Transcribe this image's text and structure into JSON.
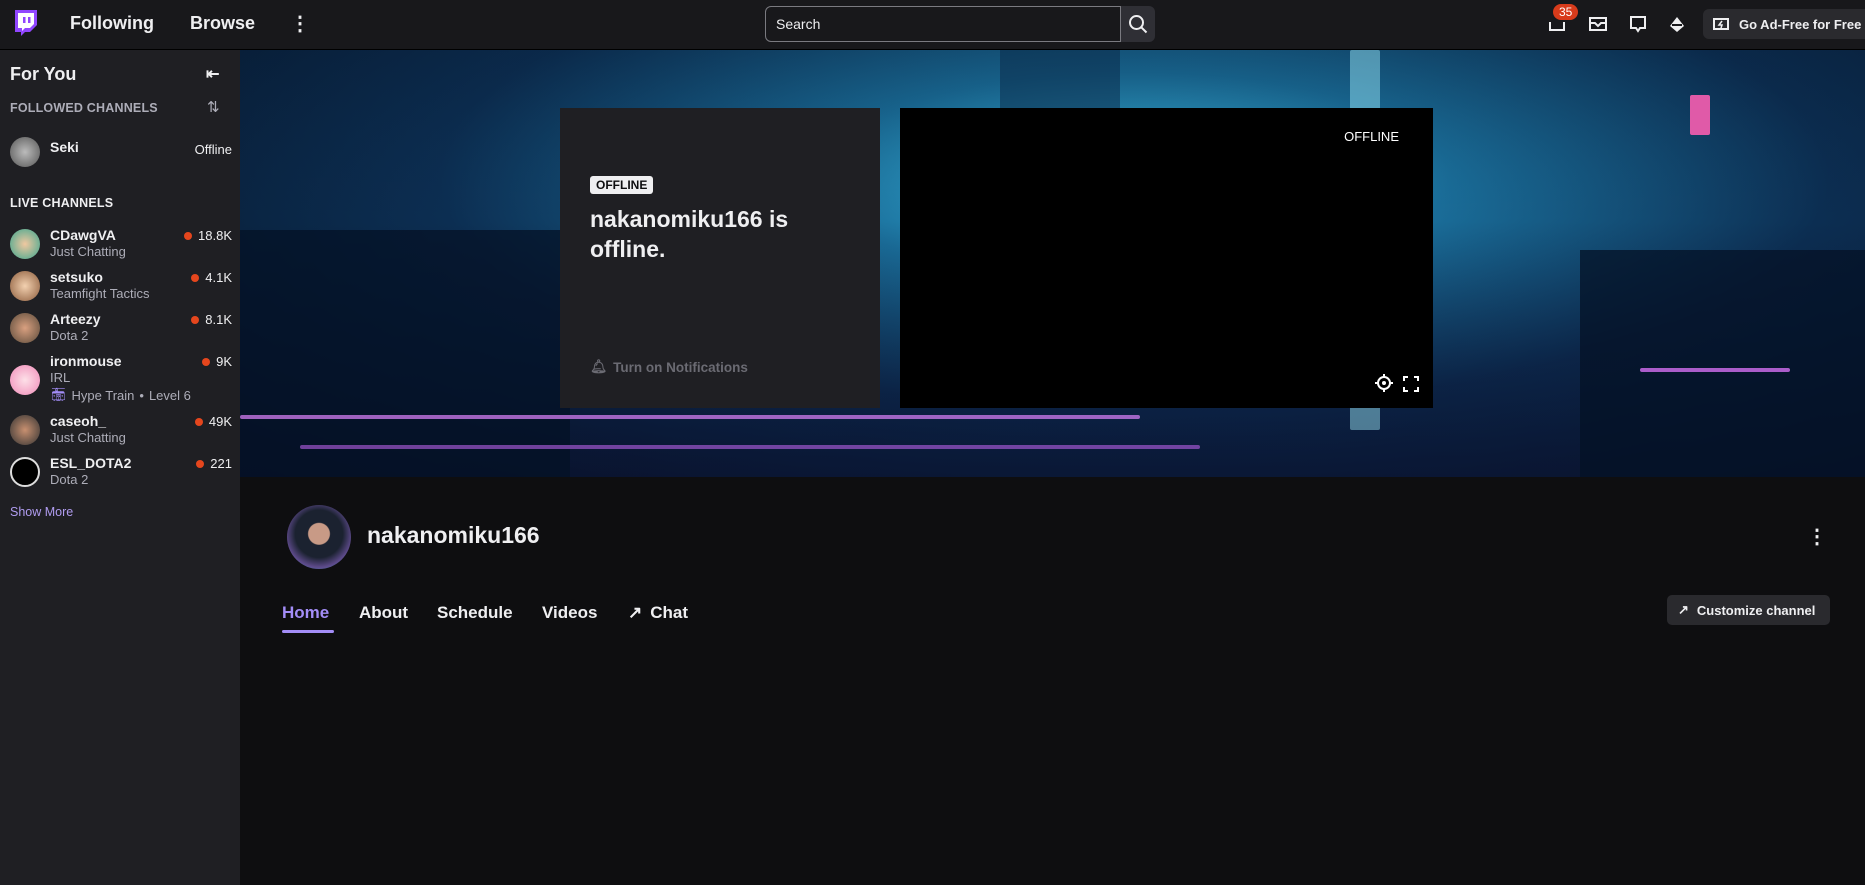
{
  "topbar": {
    "following": "Following",
    "browse": "Browse",
    "search_placeholder": "Search",
    "notification_count": "35",
    "ad_free": "Go Ad-Free for Free"
  },
  "sidebar": {
    "title": "For You",
    "followed_header": "FOLLOWED CHANNELS",
    "followed": [
      {
        "name": "Seki",
        "status": "Offline"
      }
    ],
    "live_header": "LIVE CHANNELS",
    "live": [
      {
        "name": "CDawgVA",
        "game": "Just Chatting",
        "viewers": "18.8K"
      },
      {
        "name": "setsuko",
        "game": "Teamfight Tactics",
        "viewers": "4.1K"
      },
      {
        "name": "Arteezy",
        "game": "Dota 2",
        "viewers": "8.1K"
      },
      {
        "name": "ironmouse",
        "game": "IRL",
        "viewers": "9K",
        "hype": "Hype Train",
        "hype_sep": "•",
        "hype_level": "Level 6"
      },
      {
        "name": "caseoh_",
        "game": "Just Chatting",
        "viewers": "49K"
      },
      {
        "name": "ESL_DOTA2",
        "game": "Dota 2",
        "viewers": "221"
      }
    ],
    "show_more": "Show More"
  },
  "offline_card": {
    "pill": "OFFLINE",
    "title": "nakanomiku166 is offline.",
    "notify": "Turn on Notifications"
  },
  "player": {
    "status": "OFFLINE"
  },
  "channel": {
    "name": "nakanomiku166",
    "tabs": [
      "Home",
      "About",
      "Schedule",
      "Videos",
      "Chat"
    ],
    "customize": "Customize channel"
  },
  "colors": {
    "accent": "#a38df7",
    "live": "#e5461d",
    "brand": "#9146ff"
  }
}
